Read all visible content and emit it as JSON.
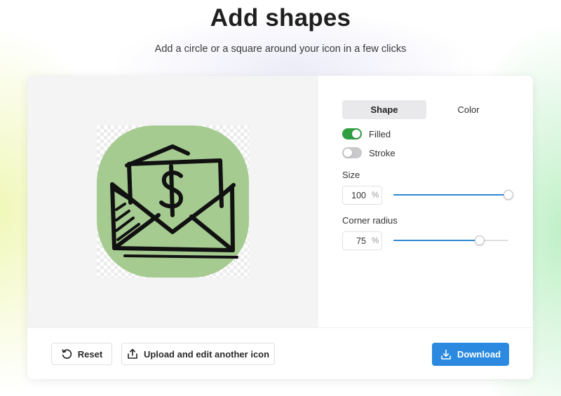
{
  "header": {
    "title": "Add shapes",
    "subtitle": "Add a circle or a square around your icon in a few clicks"
  },
  "preview": {
    "shape_fill_color": "#a5cb91",
    "icon": "envelope-with-dollar-bill-icon",
    "icon_stroke_color": "#111111"
  },
  "controls": {
    "tabs": [
      {
        "label": "Shape",
        "active": true
      },
      {
        "label": "Color",
        "active": false
      }
    ],
    "toggles": {
      "filled": {
        "label": "Filled",
        "on": true
      },
      "stroke": {
        "label": "Stroke",
        "on": false
      }
    },
    "size": {
      "label": "Size",
      "value": "100",
      "unit": "%",
      "slider_fraction": 1.0
    },
    "corner_radius": {
      "label": "Corner radius",
      "value": "75",
      "unit": "%",
      "slider_fraction": 0.75
    }
  },
  "footer": {
    "reset_label": "Reset",
    "upload_label": "Upload and edit another icon",
    "download_label": "Download"
  },
  "colors": {
    "accent_blue": "#2b8ae0",
    "toggle_on_green": "#2e9e41",
    "slider_fill": "#2f87d1"
  }
}
